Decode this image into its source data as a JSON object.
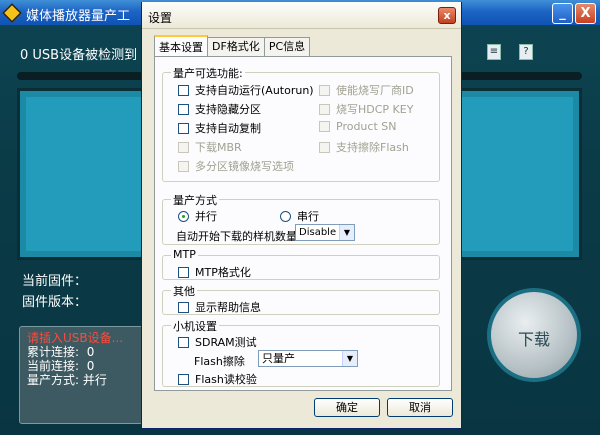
{
  "app": {
    "title": "媒体播放器量产工",
    "status": "0 USB设备被检测到",
    "current_firmware_label": "当前固件：",
    "firmware_version_label": "固件版本：",
    "log": {
      "insert_prompt": "请插入USB设备...",
      "total_connect_label": "累计连接:",
      "total_connect_value": "0",
      "current_connect_label": "当前连接:",
      "current_connect_value": "0",
      "mode_label": "量产方式:",
      "mode_value": "并行"
    },
    "download_button": "下载",
    "minimize_glyph": "_",
    "close_glyph": "X",
    "toolbar_icons": [
      "document-icon",
      "help-icon"
    ]
  },
  "dialog": {
    "title": "设置",
    "close_glyph": "x",
    "tabs": [
      "基本设置",
      "DF格式化",
      "PC信息"
    ],
    "functions_group": {
      "title": "量产可选功能:",
      "left": [
        {
          "label": "支持自动运行(Autorun)",
          "enabled": true
        },
        {
          "label": "支持隐藏分区",
          "enabled": true
        },
        {
          "label": "支持自动复制",
          "enabled": true
        },
        {
          "label": "下载MBR",
          "enabled": false
        },
        {
          "label": "多分区镜像烧写选项",
          "enabled": false
        }
      ],
      "right": [
        {
          "label": "使能烧写厂商ID",
          "enabled": false
        },
        {
          "label": "烧写HDCP KEY",
          "enabled": false
        },
        {
          "label": "Product SN",
          "enabled": false
        },
        {
          "label": "支持擦除Flash",
          "enabled": false
        }
      ]
    },
    "mode_group": {
      "title": "量产方式",
      "parallel": "并行",
      "serial": "串行",
      "selected": "并行",
      "auto_start_label": "自动开始下载的样机数量",
      "auto_start_value": "Disable"
    },
    "mtp_group": {
      "title": "MTP",
      "checkbox": "MTP格式化"
    },
    "other_group": {
      "title": "其他",
      "checkbox": "显示帮助信息"
    },
    "small_machine_group": {
      "title": "小机设置",
      "sdram_test": "SDRAM测试",
      "flash_erase_label": "Flash擦除",
      "flash_erase_value": "只量产",
      "flash_verify": "Flash读校验"
    },
    "ok_button": "确定",
    "cancel_button": "取消"
  }
}
